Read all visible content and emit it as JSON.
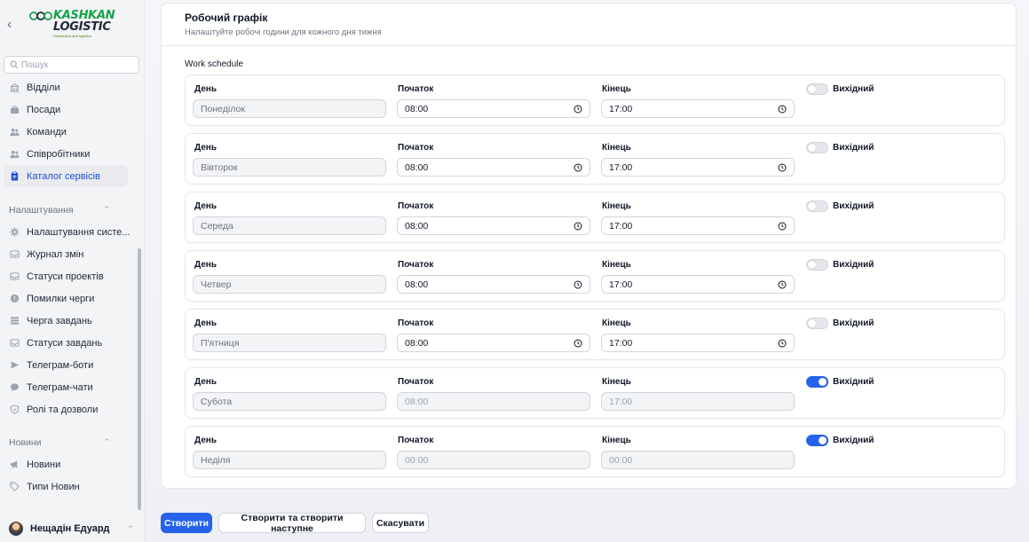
{
  "brand": {
    "line1": "KASHKAN",
    "line2": "LOGISTIC",
    "tagline": "Distribution and logistics",
    "colors": {
      "accent": "#16a34a",
      "primary": "#2563eb"
    }
  },
  "sidebar": {
    "search_placeholder": "Пошук",
    "items_top": [
      {
        "label": "Відділи",
        "icon": "building-icon"
      },
      {
        "label": "Посади",
        "icon": "briefcase-icon"
      },
      {
        "label": "Команди",
        "icon": "users-icon"
      },
      {
        "label": "Співробітники",
        "icon": "users-icon"
      },
      {
        "label": "Каталог сервісів",
        "icon": "clipboard-icon",
        "active": true
      }
    ],
    "group_settings": "Налаштування",
    "items_settings": [
      {
        "label": "Налаштування систе...",
        "icon": "gear-icon"
      },
      {
        "label": "Журнал змін",
        "icon": "inbox-icon"
      },
      {
        "label": "Статуси проектів",
        "icon": "inbox-icon"
      },
      {
        "label": "Помилки черги",
        "icon": "alert-icon"
      },
      {
        "label": "Черга завдань",
        "icon": "list-icon"
      },
      {
        "label": "Статуси завдань",
        "icon": "inbox-icon"
      },
      {
        "label": "Телеграм-боти",
        "icon": "send-icon"
      },
      {
        "label": "Телеграм-чати",
        "icon": "chat-icon"
      },
      {
        "label": "Ролі та дозволи",
        "icon": "shield-icon"
      }
    ],
    "group_news": "Новини",
    "items_news": [
      {
        "label": "Новини",
        "icon": "megaphone-icon"
      },
      {
        "label": "Типи Новин",
        "icon": "tag-icon"
      }
    ],
    "user_name": "Нещадін Едуард"
  },
  "card": {
    "title": "Робочий графік",
    "subtitle": "Налаштуйте робочі години для кожного дня тижня",
    "section_label": "Work schedule"
  },
  "labels": {
    "day": "День",
    "start": "Початок",
    "end": "Кінець",
    "day_off": "Вихідний"
  },
  "schedule": [
    {
      "day": "Понеділок",
      "start": "08:00",
      "end": "17:00",
      "day_off": false
    },
    {
      "day": "Вівторок",
      "start": "08:00",
      "end": "17:00",
      "day_off": false
    },
    {
      "day": "Середа",
      "start": "08:00",
      "end": "17:00",
      "day_off": false
    },
    {
      "day": "Четвер",
      "start": "08:00",
      "end": "17:00",
      "day_off": false
    },
    {
      "day": "П'ятниця",
      "start": "08:00",
      "end": "17:00",
      "day_off": false
    },
    {
      "day": "Субота",
      "start": "08:00",
      "end": "17:00",
      "day_off": true
    },
    {
      "day": "Неділя",
      "start": "00:00",
      "end": "00:00",
      "day_off": true
    }
  ],
  "footer": {
    "create": "Створити",
    "create_next": "Створити та створити наступне",
    "cancel": "Скасувати"
  }
}
